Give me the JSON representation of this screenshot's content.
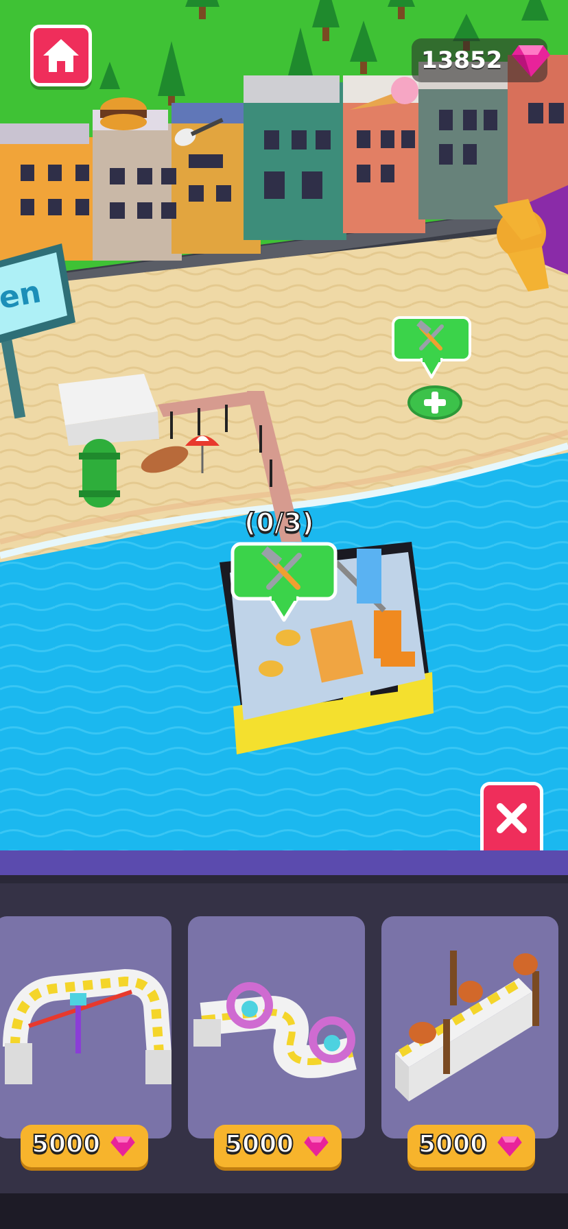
{
  "hud": {
    "gems": "13852",
    "home_icon": "home-icon",
    "gem_icon": "pink-gem-icon",
    "close_icon": "close-x-icon"
  },
  "scene": {
    "sign_text": "en",
    "build_progress": "(0/3)",
    "tool_icon": "wrench-hammer-icon",
    "add_icon": "plus-icon"
  },
  "shop": {
    "items": [
      {
        "price": "5000",
        "icon": "pink-gem-icon"
      },
      {
        "price": "5000",
        "icon": "pink-gem-icon"
      },
      {
        "price": "5000",
        "icon": "pink-gem-icon"
      }
    ]
  },
  "colors": {
    "accent_red": "#ef2e5b",
    "grass": "#3fc235",
    "water": "#1bb8ef",
    "sand": "#efd9a6",
    "panel": "#353246",
    "panel_stripe": "#5b4bae",
    "card": "#7a73a8",
    "price_button": "#f7b42c",
    "gem": "#e8239a"
  }
}
